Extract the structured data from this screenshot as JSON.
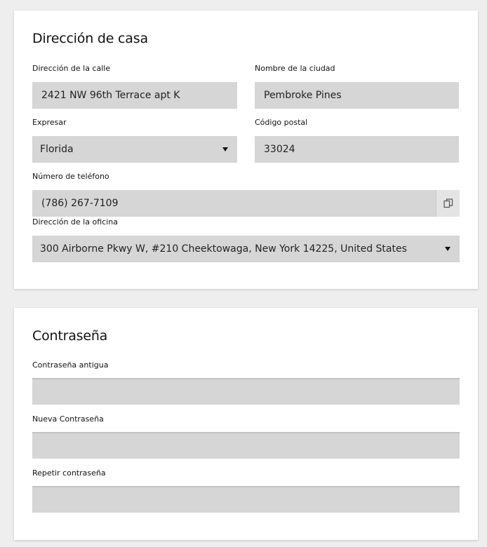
{
  "home_address": {
    "title": "Dirección de casa",
    "street": {
      "label": "Dirección de la calle",
      "value": "2421 NW 96th Terrace apt K"
    },
    "city": {
      "label": "Nombre de la ciudad",
      "value": "Pembroke Pines"
    },
    "state": {
      "label": "Expresar",
      "value": "Florida"
    },
    "zip": {
      "label": "Código postal",
      "value": "33024"
    },
    "phone": {
      "label": "Número de teléfono",
      "value": "(786) 267-7109",
      "action_icon": "copy-icon"
    },
    "office": {
      "label": "Dirección de la oficina",
      "value": "300 Airborne Pkwy W, #210 Cheektowaga, New York 14225, United States"
    }
  },
  "password": {
    "title": "Contraseña",
    "old": {
      "label": "Contraseña antigua",
      "value": ""
    },
    "new": {
      "label": "Nueva Contraseña",
      "value": ""
    },
    "repeat": {
      "label": "Repetir contraseña",
      "value": ""
    }
  }
}
